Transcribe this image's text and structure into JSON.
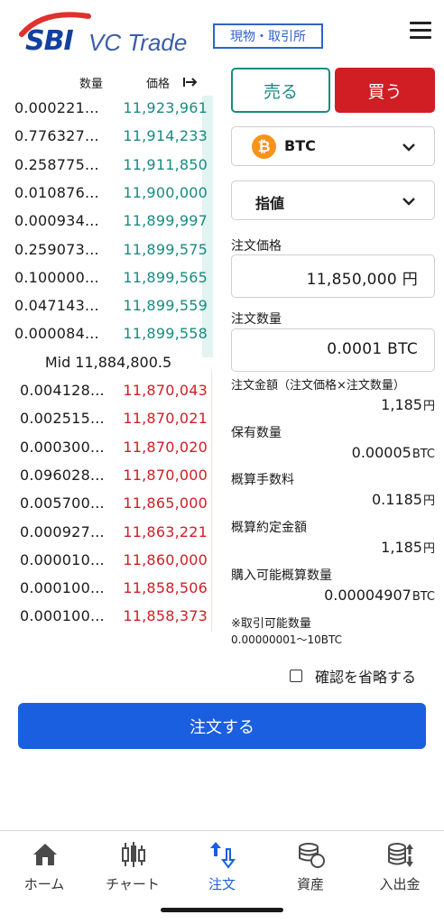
{
  "header": {
    "logo_brand": "SBI",
    "logo_product": "VC Trade",
    "market_badge": "現物・取引所"
  },
  "orderbook": {
    "qty_header": "数量",
    "price_header": "価格",
    "price_header_icon": "arrow-right-bar-icon",
    "asks": [
      {
        "qty": "0.000221...",
        "price": "11,923,961"
      },
      {
        "qty": "0.776327...",
        "price": "11,914,233"
      },
      {
        "qty": "0.258775...",
        "price": "11,911,850"
      },
      {
        "qty": "0.010876...",
        "price": "11,900,000"
      },
      {
        "qty": "0.000934...",
        "price": "11,899,997"
      },
      {
        "qty": "0.259073...",
        "price": "11,899,575"
      },
      {
        "qty": "0.100000...",
        "price": "11,899,565"
      },
      {
        "qty": "0.047143...",
        "price": "11,899,559"
      },
      {
        "qty": "0.000084...",
        "price": "11,899,558"
      }
    ],
    "mid": "Mid 11,884,800.5",
    "bids": [
      {
        "qty": "0.004128...",
        "price": "11,870,043"
      },
      {
        "qty": "0.002515...",
        "price": "11,870,021"
      },
      {
        "qty": "0.000300...",
        "price": "11,870,020"
      },
      {
        "qty": "0.096028...",
        "price": "11,870,000"
      },
      {
        "qty": "0.005700...",
        "price": "11,865,000"
      },
      {
        "qty": "0.000927...",
        "price": "11,863,221"
      },
      {
        "qty": "0.000010...",
        "price": "11,860,000"
      },
      {
        "qty": "0.000100...",
        "price": "11,858,506"
      },
      {
        "qty": "0.000100...",
        "price": "11,858,373"
      }
    ],
    "ask_color": "#1a8a80",
    "bid_color": "#d01e24"
  },
  "order": {
    "sell_label": "売る",
    "buy_label": "買う",
    "coin": "BTC",
    "order_type": "指値",
    "price_label": "注文価格",
    "price_value": "11,850,000 円",
    "qty_label": "注文数量",
    "qty_value": "0.0001 BTC",
    "amount_label": "注文金額（注文価格×注文数量）",
    "amount_value": "1,185",
    "amount_unit": "円",
    "holding_label": "保有数量",
    "holding_value": "0.00005",
    "holding_unit": "BTC",
    "fee_label": "概算手数料",
    "fee_value": "0.1185",
    "fee_unit": "円",
    "settle_label": "概算約定金額",
    "settle_value": "1,185",
    "settle_unit": "円",
    "buyable_label": "購入可能概算数量",
    "buyable_value": "0.00004907",
    "buyable_unit": "BTC",
    "range_note": "※取引可能数量",
    "range_value": "0.00000001〜10BTC",
    "skip_confirm_label": "確認を省略する",
    "submit_label": "注文する"
  },
  "nav": {
    "items": [
      {
        "label": "ホーム",
        "icon": "home-icon"
      },
      {
        "label": "チャート",
        "icon": "candlestick-icon"
      },
      {
        "label": "注文",
        "icon": "order-icon"
      },
      {
        "label": "資産",
        "icon": "assets-icon"
      },
      {
        "label": "入出金",
        "icon": "deposit-withdraw-icon"
      }
    ],
    "active_color": "#1a5fe0"
  }
}
